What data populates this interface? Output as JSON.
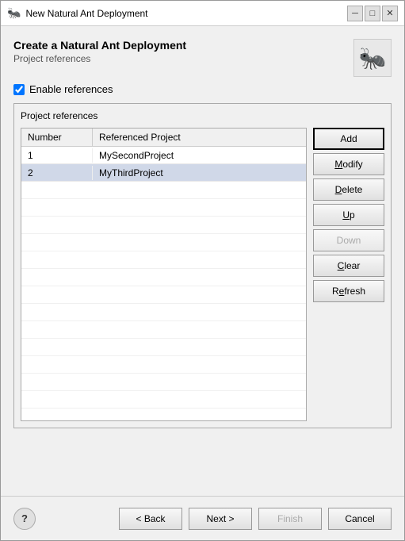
{
  "window": {
    "title": "New Natural Ant Deployment",
    "icon": "🐜"
  },
  "header": {
    "title": "Create a Natural Ant Deployment",
    "subtitle": "Project references"
  },
  "checkbox": {
    "label": "Enable references",
    "checked": true
  },
  "group": {
    "title": "Project references"
  },
  "table": {
    "columns": [
      "Number",
      "Referenced Project"
    ],
    "rows": [
      {
        "number": "1",
        "project": "MySecondProject",
        "selected": false
      },
      {
        "number": "2",
        "project": "MyThirdProject",
        "selected": true
      }
    ]
  },
  "buttons": {
    "add": "Add",
    "modify": "Modify",
    "delete": "Delete",
    "up": "Up",
    "down": "Down",
    "clear": "Clear",
    "refresh": "Refresh"
  },
  "footer": {
    "help": "?",
    "back": "< Back",
    "next": "Next >",
    "finish": "Finish",
    "cancel": "Cancel"
  }
}
